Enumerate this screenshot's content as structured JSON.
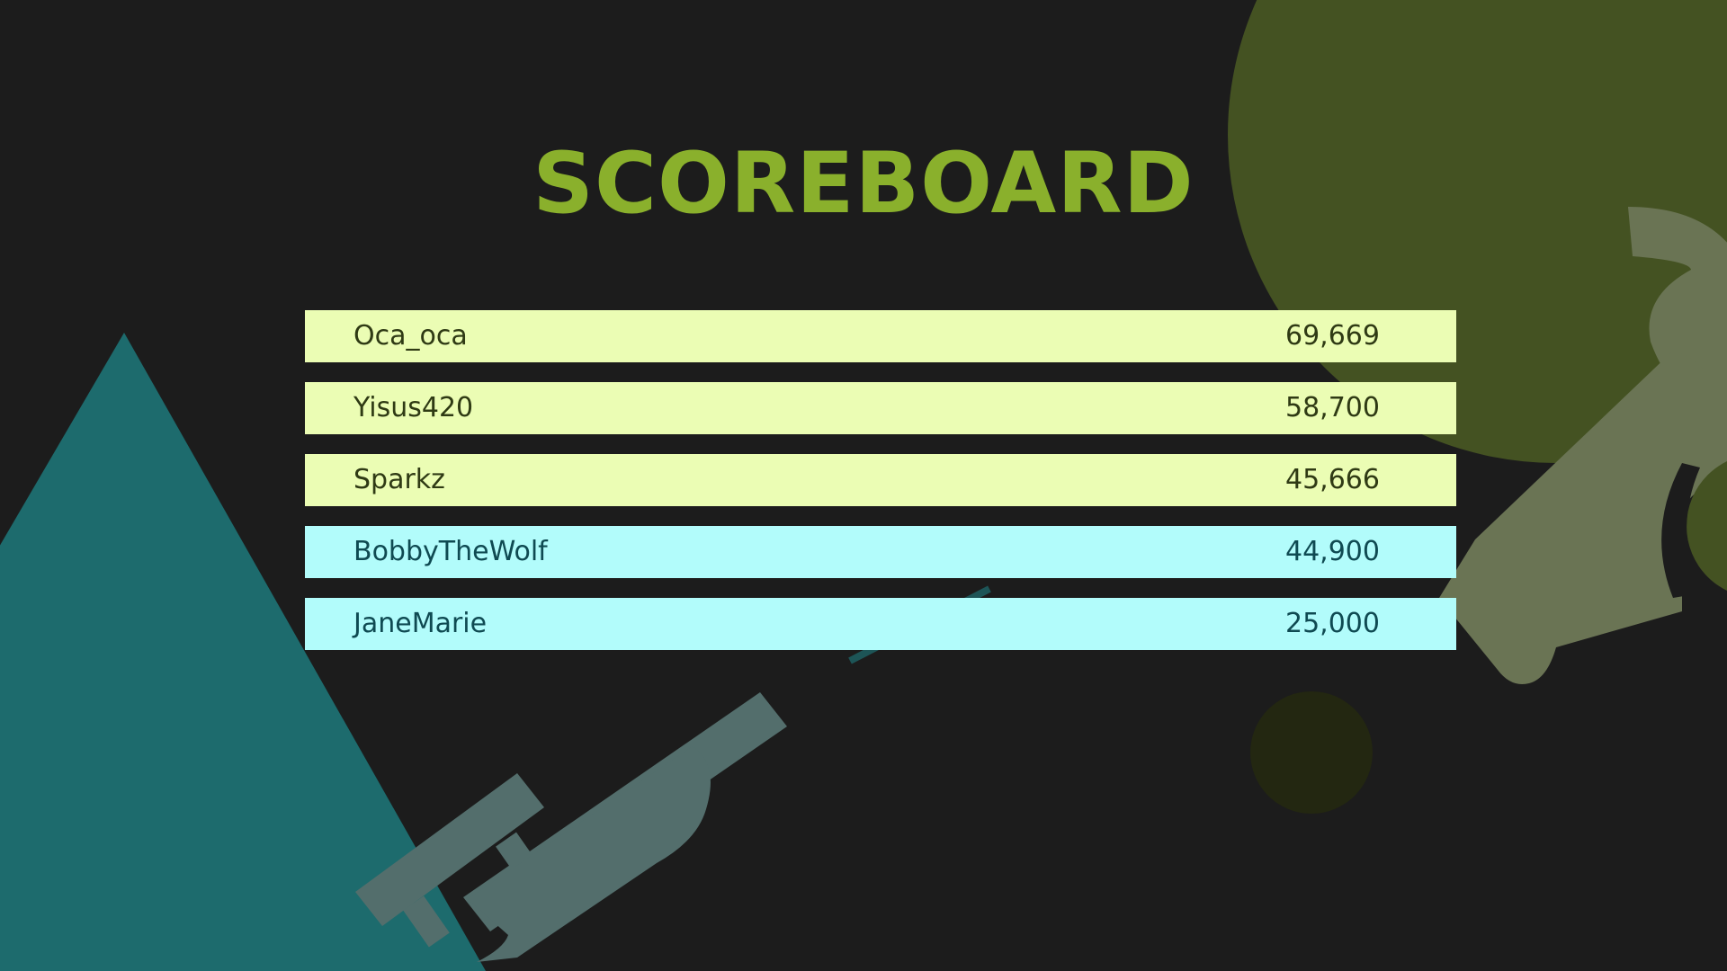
{
  "colors": {
    "background": "#1c1c1c",
    "title": "#8ab02c",
    "row_green": "#ebfdb4",
    "row_cyan": "#b2fcfb",
    "text_dark_green": "#2f3a14",
    "text_dark_teal": "#0f4a52",
    "deco_olive": "#445222",
    "deco_teal": "#1d6b6d",
    "deco_gray": "#6a7454",
    "deco_slate": "#536e6c",
    "deco_dark_olive": "#232711"
  },
  "title": "SCOREBOARD",
  "rows": [
    {
      "name": "Oca_oca",
      "score": "69,669",
      "style": "green"
    },
    {
      "name": "Yisus420",
      "score": "58,700",
      "style": "green"
    },
    {
      "name": "Sparkz",
      "score": "45,666",
      "style": "green"
    },
    {
      "name": "BobbyTheWolf",
      "score": "44,900",
      "style": "cyan"
    },
    {
      "name": "JaneMarie",
      "score": "25,000",
      "style": "cyan"
    }
  ],
  "decorations": [
    "olive-circle",
    "teal-triangle",
    "sled-icon",
    "trophy-icon",
    "small-circle"
  ]
}
